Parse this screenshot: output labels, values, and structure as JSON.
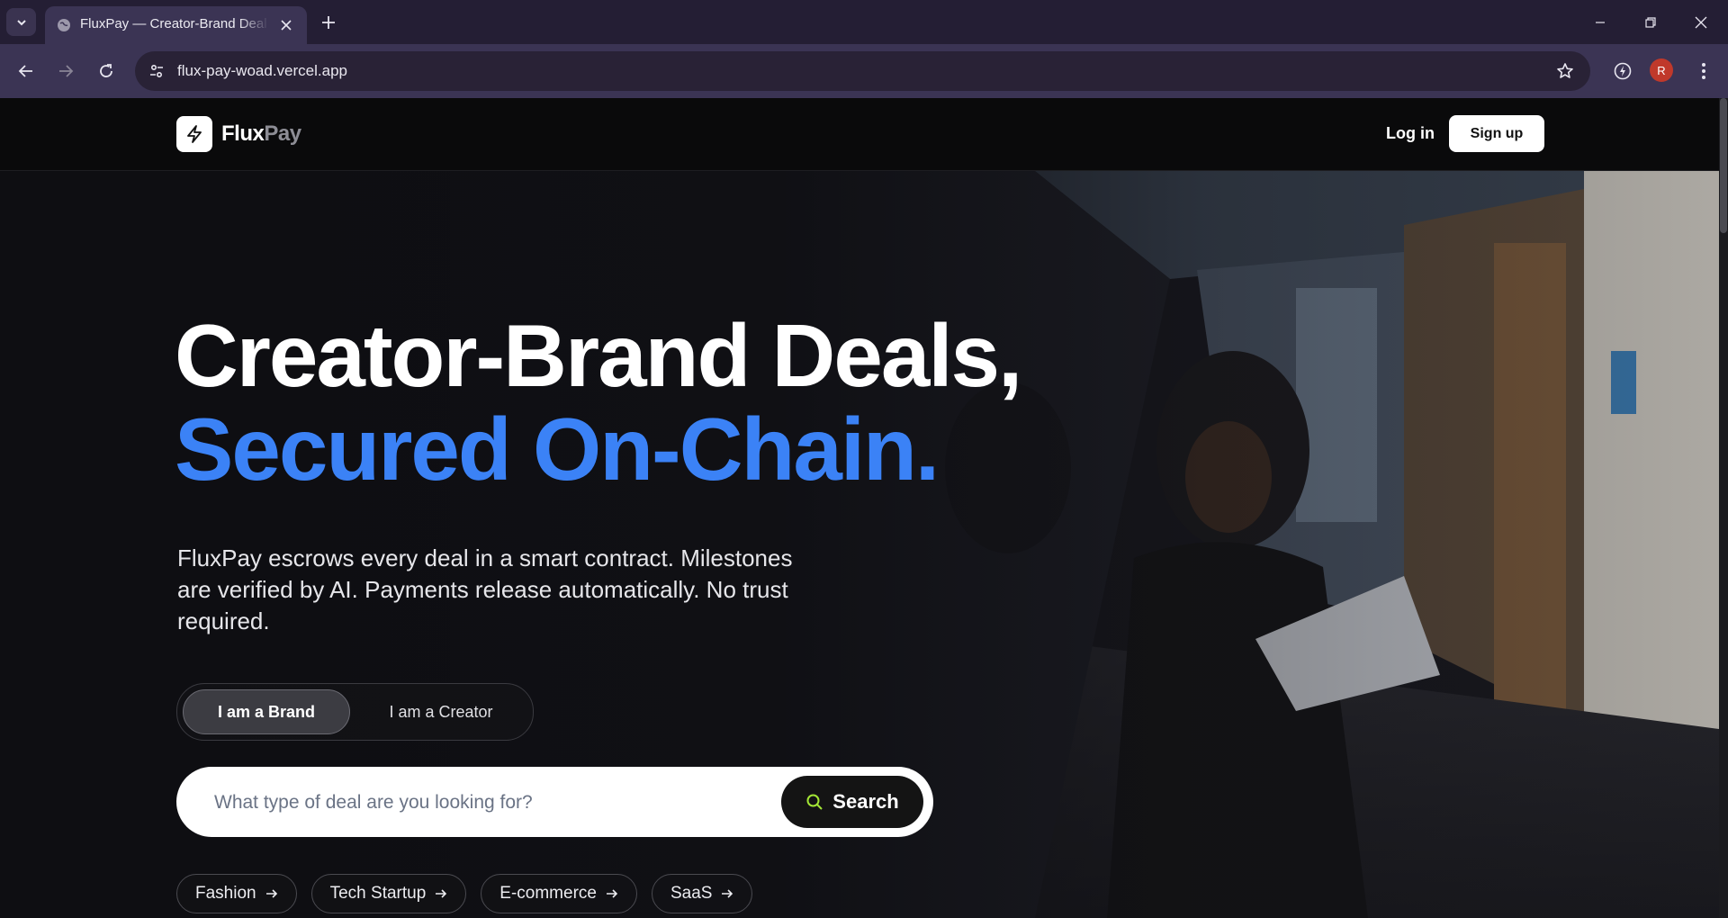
{
  "browser": {
    "tab_title": "FluxPay — Creator-Brand Deal Escrow",
    "url": "flux-pay-woad.vercel.app",
    "profile_initial": "R"
  },
  "header": {
    "logo_part1": "Flux",
    "logo_part2": "Pay",
    "login_label": "Log in",
    "signup_label": "Sign up"
  },
  "hero": {
    "title_line1": "Creator-Brand Deals,",
    "title_line2": "Secured On-Chain.",
    "subtitle": "FluxPay escrows every deal in a smart contract. Milestones are verified by AI. Payments release automatically. No trust required.",
    "accent_color": "#3b82f6"
  },
  "role_toggle": {
    "options": [
      "I am a Brand",
      "I am a Creator"
    ],
    "selected": "I am a Brand"
  },
  "search": {
    "placeholder": "What type of deal are you looking for?",
    "button_label": "Search"
  },
  "categories": [
    "Fashion",
    "Tech Startup",
    "E-commerce",
    "SaaS"
  ]
}
